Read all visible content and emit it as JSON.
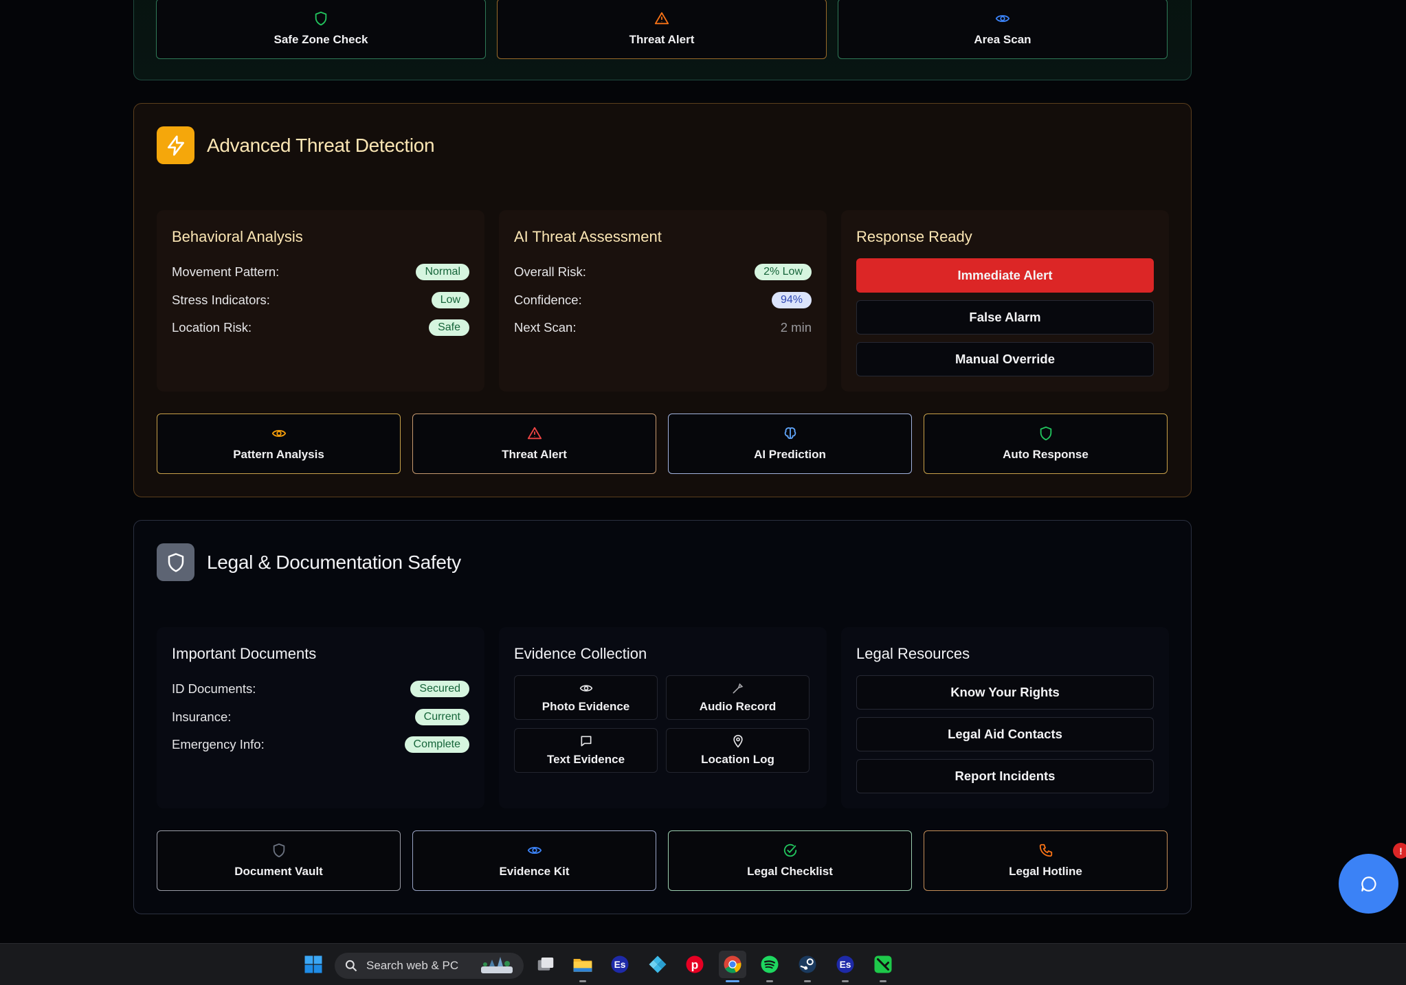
{
  "top_section": {
    "tiles": [
      {
        "label": "Safe Zone Check",
        "icon": "shield-icon",
        "color": "#22c55e"
      },
      {
        "label": "Threat Alert",
        "icon": "warning-triangle-icon",
        "color": "#f97316"
      },
      {
        "label": "Area Scan",
        "icon": "eye-icon",
        "color": "#3b82f6"
      }
    ]
  },
  "threat_section": {
    "title": "Advanced Threat Detection",
    "icon": "lightning-icon",
    "accent": "#f59e0b",
    "behavioral": {
      "title": "Behavioral Analysis",
      "rows": [
        {
          "label": "Movement Pattern:",
          "value": "Normal"
        },
        {
          "label": "Stress Indicators:",
          "value": "Low"
        },
        {
          "label": "Location Risk:",
          "value": "Safe"
        }
      ]
    },
    "ai": {
      "title": "AI Threat Assessment",
      "rows": [
        {
          "label": "Overall Risk:",
          "value": "2% Low"
        },
        {
          "label": "Confidence:",
          "value": "94%"
        },
        {
          "label": "Next Scan:",
          "value": "2 min"
        }
      ]
    },
    "response": {
      "title": "Response Ready",
      "buttons": [
        "Immediate Alert",
        "False Alarm",
        "Manual Override"
      ]
    },
    "tiles": [
      {
        "label": "Pattern Analysis",
        "icon": "eye-icon",
        "color": "#f59e0b"
      },
      {
        "label": "Threat Alert",
        "icon": "warning-triangle-icon",
        "color": "#ef4444"
      },
      {
        "label": "AI Prediction",
        "icon": "brain-icon",
        "color": "#60a5fa"
      },
      {
        "label": "Auto Response",
        "icon": "shield-icon",
        "color": "#22c55e"
      }
    ]
  },
  "legal_section": {
    "title": "Legal & Documentation Safety",
    "icon": "shield-icon",
    "documents": {
      "title": "Important Documents",
      "rows": [
        {
          "label": "ID Documents:",
          "value": "Secured"
        },
        {
          "label": "Insurance:",
          "value": "Current"
        },
        {
          "label": "Emergency Info:",
          "value": "Complete"
        }
      ]
    },
    "evidence": {
      "title": "Evidence Collection",
      "items": [
        {
          "label": "Photo Evidence",
          "icon": "eye-icon"
        },
        {
          "label": "Audio Record",
          "icon": "microphone-icon"
        },
        {
          "label": "Text Evidence",
          "icon": "message-icon"
        },
        {
          "label": "Location Log",
          "icon": "map-pin-icon"
        }
      ]
    },
    "resources": {
      "title": "Legal Resources",
      "buttons": [
        "Know Your Rights",
        "Legal Aid Contacts",
        "Report Incidents"
      ]
    },
    "tiles": [
      {
        "label": "Document Vault",
        "icon": "shield-icon",
        "color": "#6b7280"
      },
      {
        "label": "Evidence Kit",
        "icon": "eye-icon",
        "color": "#3b82f6"
      },
      {
        "label": "Legal Checklist",
        "icon": "check-circle-icon",
        "color": "#22c55e"
      },
      {
        "label": "Legal Hotline",
        "icon": "phone-icon",
        "color": "#f97316"
      }
    ]
  },
  "chat": {
    "badge": "!",
    "icon": "chat-icon"
  },
  "taskbar": {
    "search_placeholder": "Search web & PC",
    "apps": [
      "start-icon",
      "task-view-icon",
      "file-explorer-icon",
      "app-icon",
      "kodi-icon",
      "pinterest-icon",
      "chrome-icon",
      "spotify-icon",
      "steam-icon",
      "app-icon",
      "app-icon"
    ]
  }
}
